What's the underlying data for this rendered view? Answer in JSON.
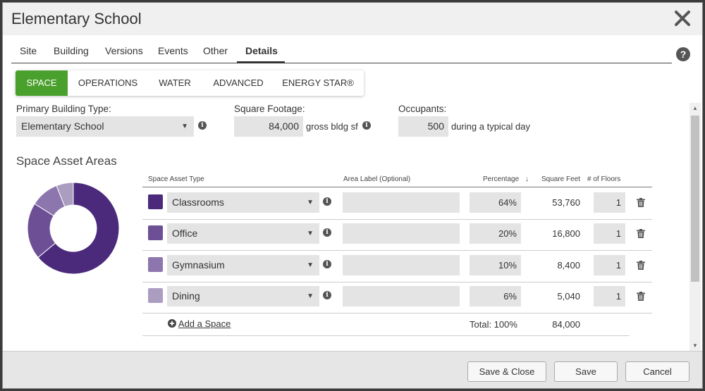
{
  "window": {
    "title": "Elementary School"
  },
  "top_tabs": [
    "Site",
    "Building",
    "Versions",
    "Events",
    "Other",
    "Details"
  ],
  "sub_tabs": [
    "SPACE",
    "OPERATIONS",
    "WATER",
    "ADVANCED",
    "ENERGY STAR®"
  ],
  "building": {
    "type_label": "Primary Building Type:",
    "type_value": "Elementary School",
    "sqft_label": "Square Footage:",
    "sqft_value": "84,000",
    "sqft_unit": "gross bldg sf",
    "occupants_label": "Occupants:",
    "occupants_value": "500",
    "occupants_unit": "during a typical day"
  },
  "space_assets": {
    "title": "Space Asset Areas",
    "columns": {
      "type": "Space Asset Type",
      "area_label": "Area Label (Optional)",
      "percentage": "Percentage",
      "sort_arrow": "↓",
      "sqft": "Square Feet",
      "floors": "# of Floors"
    },
    "rows": [
      {
        "type": "Classrooms",
        "label": "",
        "percentage": "64%",
        "sqft": "53,760",
        "floors": "1",
        "color": "#4b2a7c"
      },
      {
        "type": "Office",
        "label": "",
        "percentage": "20%",
        "sqft": "16,800",
        "floors": "1",
        "color": "#6d4f96"
      },
      {
        "type": "Gymnasium",
        "label": "",
        "percentage": "10%",
        "sqft": "8,400",
        "floors": "1",
        "color": "#8c76ad"
      },
      {
        "type": "Dining",
        "label": "",
        "percentage": "6%",
        "sqft": "5,040",
        "floors": "1",
        "color": "#aa9dc0"
      }
    ],
    "add_label": "Add a Space",
    "total_pct": "Total: 100%",
    "total_sqft": "84,000"
  },
  "donut": {
    "values": [
      64,
      20,
      10,
      6
    ],
    "colors": [
      "#4b2a7c",
      "#6d4f96",
      "#8c76ad",
      "#aa9dc0"
    ]
  },
  "footer": {
    "save_close": "Save & Close",
    "save": "Save",
    "cancel": "Cancel"
  },
  "accent_color": "#4aa02c"
}
